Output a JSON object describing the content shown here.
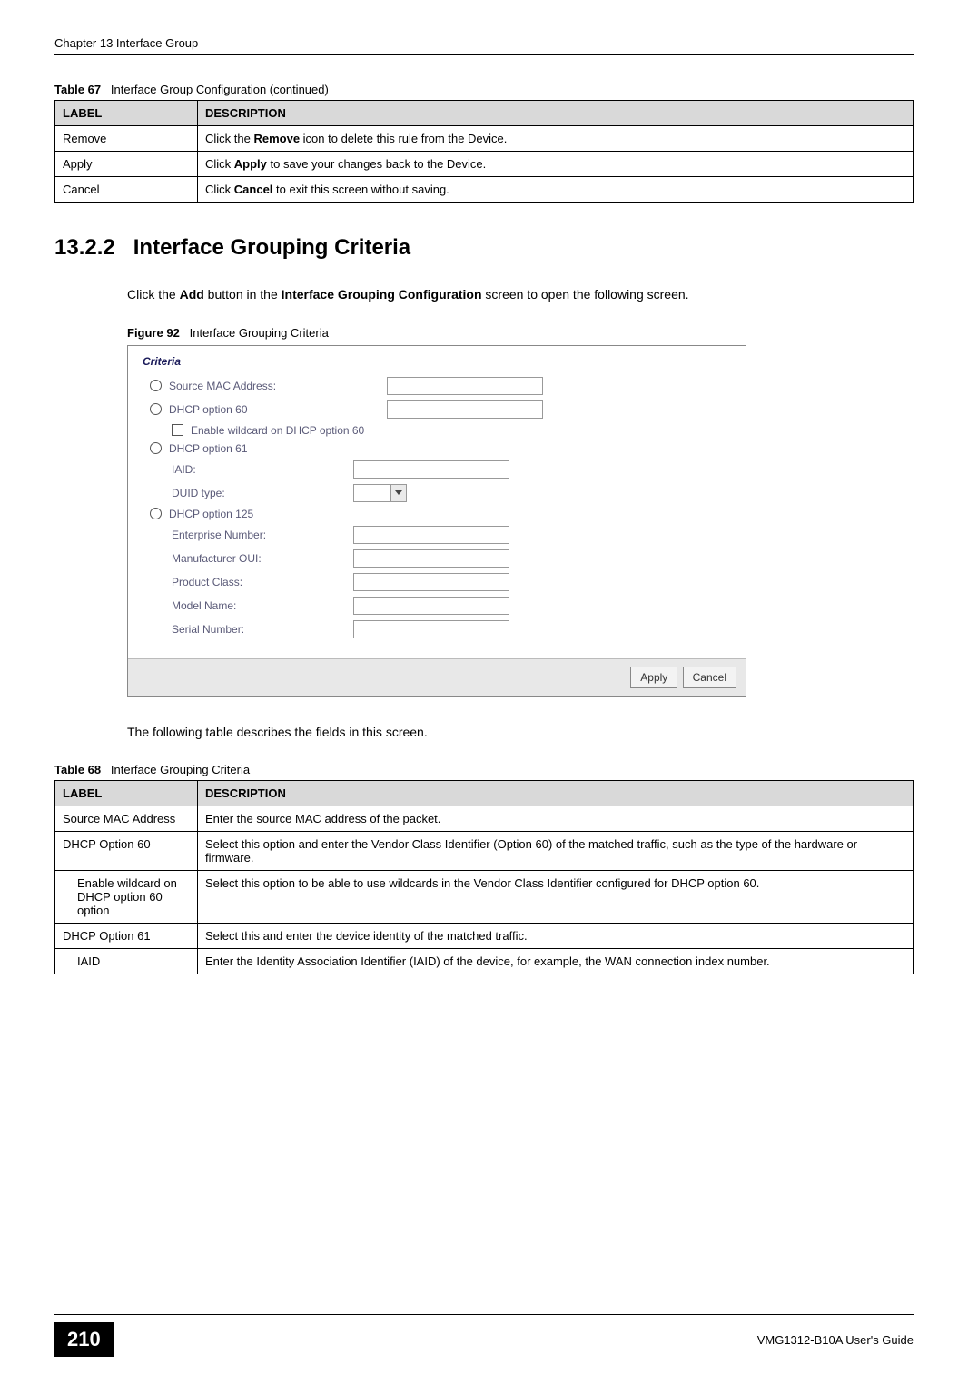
{
  "header": {
    "chapter": "Chapter 13 Interface Group"
  },
  "table_headers": {
    "label": "LABEL",
    "description": "DESCRIPTION"
  },
  "table67": {
    "number": "Table 67",
    "title": "Interface Group Configuration (continued)",
    "rows": [
      {
        "label": "Remove",
        "bold": "Remove"
      },
      {
        "label": "Apply",
        "bold": "Apply"
      },
      {
        "label": "Cancel",
        "bold": "Cancel"
      }
    ]
  },
  "section": {
    "number": "13.2.2",
    "title": "Interface Grouping Criteria",
    "intro_bold1": "Add",
    "intro_bold2": "Interface Grouping Configuration"
  },
  "figure": {
    "number": "Figure 92",
    "title": "Interface Grouping Criteria",
    "form": {
      "criteria_title": "Criteria",
      "source_mac": "Source MAC Address:",
      "dhcp60": "DHCP option 60",
      "wildcard60": "Enable wildcard on DHCP option 60",
      "dhcp61": "DHCP option 61",
      "iaid": "IAID:",
      "duid": "DUID type:",
      "dhcp125": "DHCP option 125",
      "enterprise": "Enterprise Number:",
      "manufacturer": "Manufacturer OUI:",
      "product_class": "Product Class:",
      "model_name": "Model Name:",
      "serial": "Serial Number:"
    },
    "buttons": {
      "apply": "Apply",
      "cancel": "Cancel"
    }
  },
  "table68": {
    "intro": "The following table describes the fields in this screen.",
    "number": "Table 68",
    "title": "Interface Grouping Criteria",
    "rows": [
      {
        "label": "Source MAC Address",
        "desc": "Enter the source MAC address of the packet."
      },
      {
        "label": "DHCP Option 60",
        "desc": "Select this option and enter the Vendor Class Identifier (Option 60) of the matched traffic, such as the type of the hardware or firmware."
      },
      {
        "label": "Enable wildcard on DHCP option 60 option",
        "desc": "Select this option to be able to use wildcards in the Vendor Class Identifier configured for DHCP option 60."
      },
      {
        "label": "DHCP Option 61",
        "desc": "Select this and enter the device identity of the matched traffic."
      },
      {
        "label": "IAID",
        "desc": "Enter the Identity Association Identifier (IAID) of the device, for example, the WAN connection index number."
      }
    ]
  },
  "footer": {
    "page": "210",
    "guide": "VMG1312-B10A User's Guide"
  }
}
